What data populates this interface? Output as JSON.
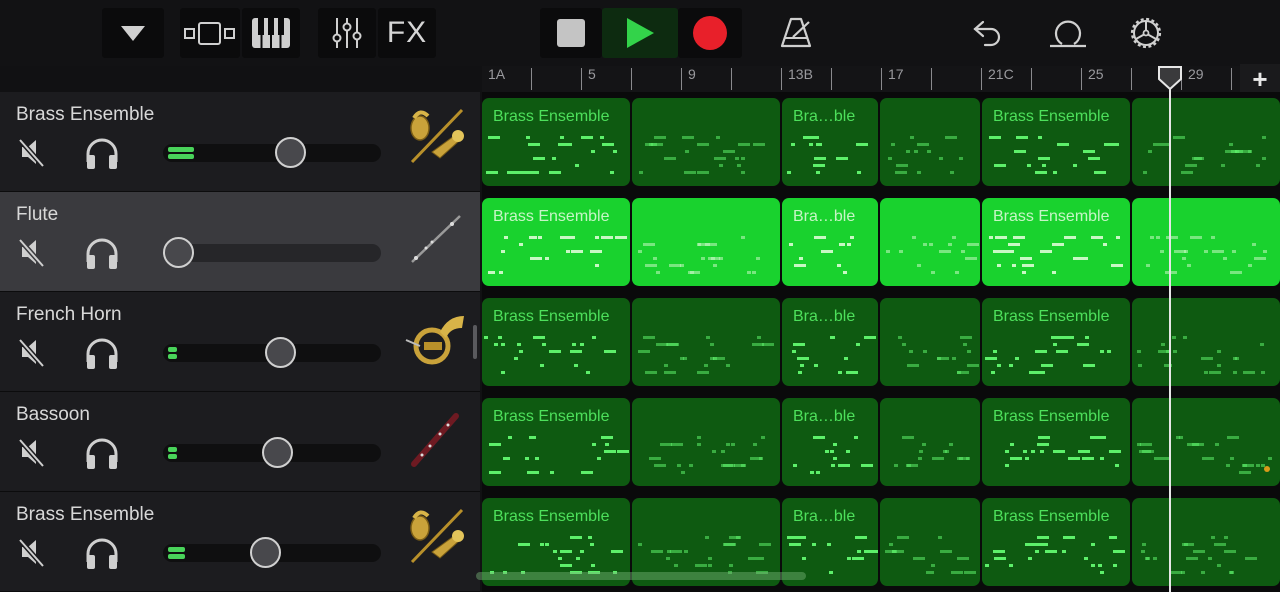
{
  "toolbar": {
    "browser_toggle": "triangle-down",
    "tracks_view": "tracks-view",
    "keyboard": "piano-keyboard",
    "mixer": "mixer-sliders",
    "fx_label": "FX",
    "stop": "stop",
    "play": "play",
    "record": "record",
    "metronome": "metronome",
    "undo": "undo",
    "loop_browser": "loop",
    "settings": "settings-gear"
  },
  "colors": {
    "region_dark": "#0e5a11",
    "region_selected": "#19d22e",
    "play_green": "#33d34a",
    "record_red": "#e8202a",
    "meter_green": "#49d35a"
  },
  "ruler": {
    "labels": [
      "1A",
      "5",
      "9",
      "13B",
      "17",
      "21C",
      "25",
      "29"
    ],
    "add_label": "+"
  },
  "tracks": [
    {
      "name": "Brass Ensemble",
      "instrument": "brass-ensemble",
      "volume": 0.6,
      "meter_level": 0.12,
      "selected": false
    },
    {
      "name": "Flute",
      "instrument": "flute",
      "volume": 0.0,
      "meter_level": 0.0,
      "selected": true
    },
    {
      "name": "French Horn",
      "instrument": "french-horn",
      "volume": 0.55,
      "meter_level": 0.04,
      "selected": false
    },
    {
      "name": "Bassoon",
      "instrument": "bassoon",
      "volume": 0.53,
      "meter_level": 0.04,
      "selected": false
    },
    {
      "name": "Brass Ensemble",
      "instrument": "brass-ensemble",
      "volume": 0.47,
      "meter_level": 0.08,
      "selected": false
    }
  ],
  "regions": {
    "labels": [
      "Brass Ensemble",
      "Bra…ble",
      "Brass Ensemble"
    ]
  }
}
